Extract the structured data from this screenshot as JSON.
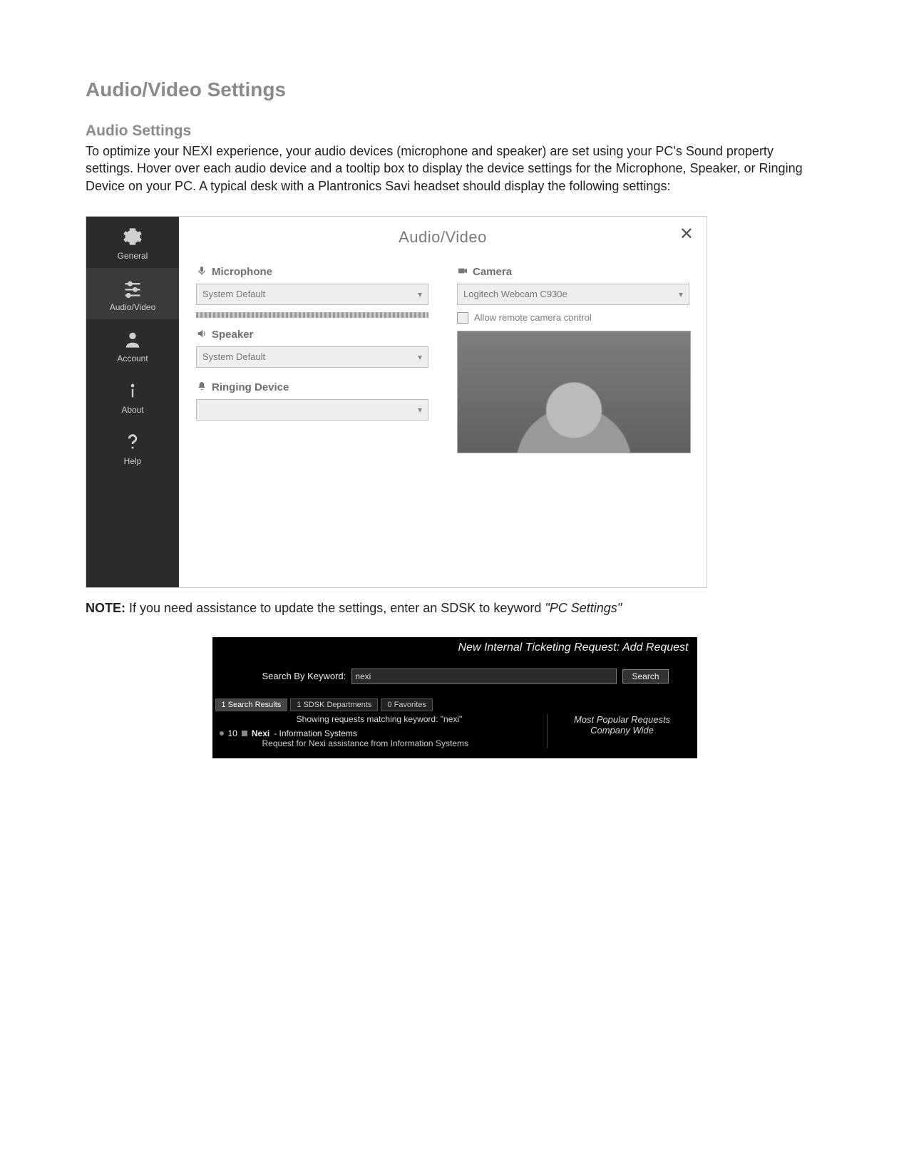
{
  "page_title": "Audio/Video Settings",
  "section_title": "Audio Settings",
  "intro_text": "To optimize your NEXI experience, your audio devices (microphone and speaker) are set using your PC's Sound property settings. Hover over each audio device and a tooltip box to display the device settings for the Microphone, Speaker, or Ringing Device on your PC. A typical desk with a Plantronics Savi headset should display the following settings:",
  "note": {
    "prefix": "NOTE:",
    "body": " If you need assistance to update the settings, enter an SDSK to keyword ",
    "italic": "\"PC Settings\""
  },
  "settings": {
    "panel_title": "Audio/Video",
    "sidebar": [
      {
        "label": "General",
        "icon": "gear-icon"
      },
      {
        "label": "Audio/Video",
        "icon": "sliders-icon"
      },
      {
        "label": "Account",
        "icon": "person-icon"
      },
      {
        "label": "About",
        "icon": "info-icon"
      },
      {
        "label": "Help",
        "icon": "help-icon"
      }
    ],
    "microphone": {
      "label": "Microphone",
      "value": "System Default"
    },
    "speaker": {
      "label": "Speaker",
      "value": "System Default"
    },
    "ringing": {
      "label": "Ringing Device",
      "value": ""
    },
    "camera": {
      "label": "Camera",
      "value": "Logitech Webcam C930e"
    },
    "allow_remote": "Allow remote camera control"
  },
  "ticket": {
    "title": "New Internal Ticketing Request: Add Request",
    "search_label": "Search By Keyword:",
    "search_value": "nexi",
    "search_button": "Search",
    "tabs": [
      "1 Search Results",
      "1 SDSK Departments",
      "0 Favorites"
    ],
    "matching_line": "Showing requests matching keyword: \"nexi\"",
    "result_line1_left": "10",
    "result_line1_bold": "Nexi",
    "result_line1_rest": " - Information Systems",
    "result_line2": "Request for Nexi assistance from Information Systems",
    "right_line1": "Most Popular Requests",
    "right_line2": "Company Wide"
  }
}
